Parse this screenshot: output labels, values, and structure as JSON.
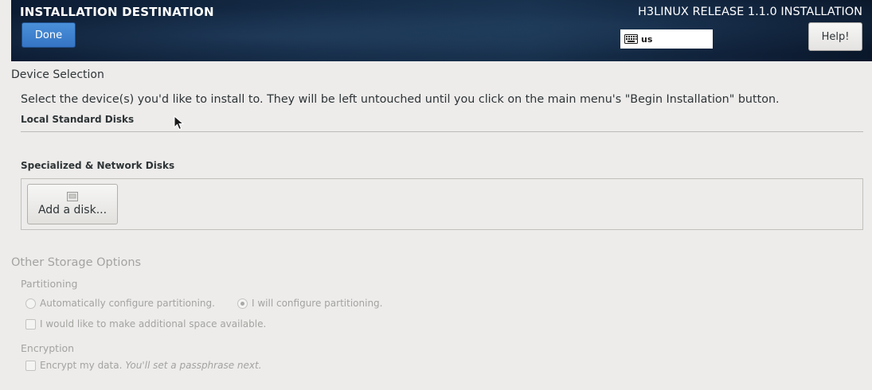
{
  "header": {
    "spoke_title": "INSTALLATION DESTINATION",
    "product_title": "H3LINUX RELEASE 1.1.0 INSTALLATION",
    "done_label": "Done",
    "help_label": "Help!",
    "keyboard_layout": "us",
    "keyboard_icon": "keyboard-icon"
  },
  "device_selection": {
    "heading": "Device Selection",
    "instructions": "Select the device(s) you'd like to install to.  They will be left untouched until you click on the main menu's \"Begin Installation\" button.",
    "local_heading": "Local Standard Disks",
    "specialized_heading": "Specialized & Network Disks",
    "add_disk_label": "Add a disk...",
    "add_disk_icon": "disk-icon"
  },
  "other_options": {
    "heading": "Other Storage Options",
    "partitioning_label": "Partitioning",
    "auto_partition_label": "Automatically configure partitioning.",
    "manual_partition_label": "I will configure partitioning.",
    "manual_partition_selected": true,
    "additional_space_label": "I would like to make additional space available.",
    "encryption_label": "Encryption",
    "encrypt_label": "Encrypt my data.",
    "encrypt_hint": "You'll set a passphrase next."
  },
  "colors": {
    "header_bg": "#142a45",
    "done_button": "#3574c4",
    "disabled_text": "#a3a3a0",
    "page_bg": "#edeceb"
  }
}
